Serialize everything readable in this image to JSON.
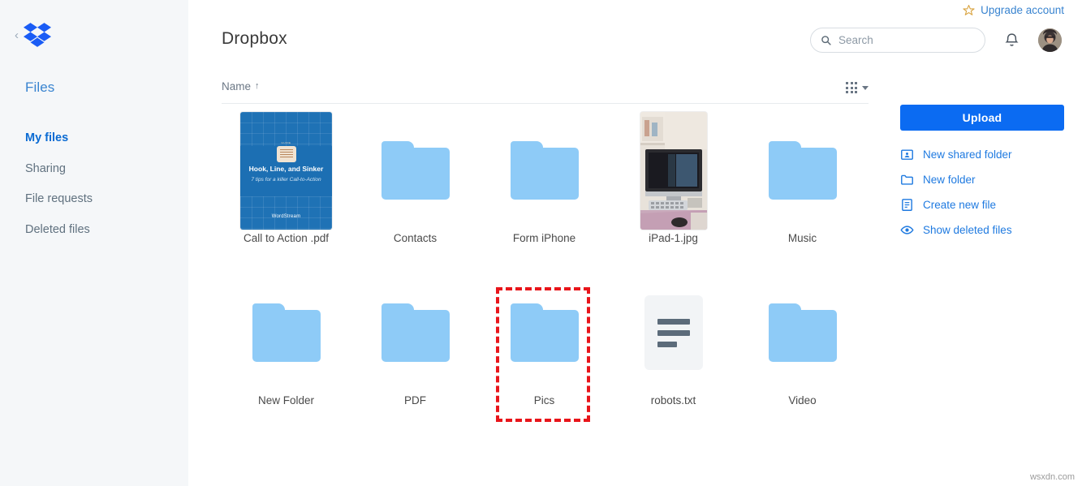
{
  "sidebar": {
    "collapse_icon": "chevron-left-icon",
    "logo": "dropbox-logo",
    "files_label": "Files",
    "items": [
      {
        "label": "My files",
        "active": true
      },
      {
        "label": "Sharing",
        "active": false
      },
      {
        "label": "File requests",
        "active": false
      },
      {
        "label": "Deleted files",
        "active": false
      }
    ]
  },
  "header": {
    "upgrade_label": "Upgrade account",
    "upgrade_icon": "star-icon",
    "title": "Dropbox",
    "search": {
      "placeholder": "Search",
      "value": "",
      "icon": "search-icon"
    },
    "notifications_icon": "bell-icon",
    "avatar": "user-avatar"
  },
  "content_header": {
    "name_column": "Name",
    "sort_arrow": "↑",
    "view_icon": "grid-view-icon",
    "view_caret": "chevron-down-icon"
  },
  "files": [
    [
      {
        "name": "Call to Action .pdf",
        "type": "pdf"
      },
      {
        "name": "Contacts",
        "type": "folder"
      },
      {
        "name": "Form iPhone",
        "type": "folder"
      },
      {
        "name": "iPad-1.jpg",
        "type": "photo"
      },
      {
        "name": "Music",
        "type": "folder"
      }
    ],
    [
      {
        "name": "New Folder",
        "type": "folder"
      },
      {
        "name": "PDF",
        "type": "folder"
      },
      {
        "name": "Pics",
        "type": "folder",
        "highlighted": true
      },
      {
        "name": "robots.txt",
        "type": "txt"
      },
      {
        "name": "Video",
        "type": "folder"
      }
    ]
  ],
  "pdf_cover": {
    "guide_label": "GUIDE",
    "title": "Hook, Line, and Sinker",
    "subtitle": "7 tips for a killer Call-to-Action",
    "brand": "WordStream"
  },
  "right_panel": {
    "upload_label": "Upload",
    "actions": [
      {
        "label": "New shared folder",
        "icon": "shared-folder-icon"
      },
      {
        "label": "New folder",
        "icon": "folder-icon"
      },
      {
        "label": "Create new file",
        "icon": "document-icon"
      },
      {
        "label": "Show deleted files",
        "icon": "eye-icon"
      }
    ]
  },
  "colors": {
    "brand_blue": "#0b6bf2",
    "link_blue": "#1f7ae0",
    "folder_blue": "#8ecbf7",
    "highlight_red": "#e8151b",
    "sidebar_bg": "#f5f7f9"
  },
  "watermark": "wsxdn.com"
}
